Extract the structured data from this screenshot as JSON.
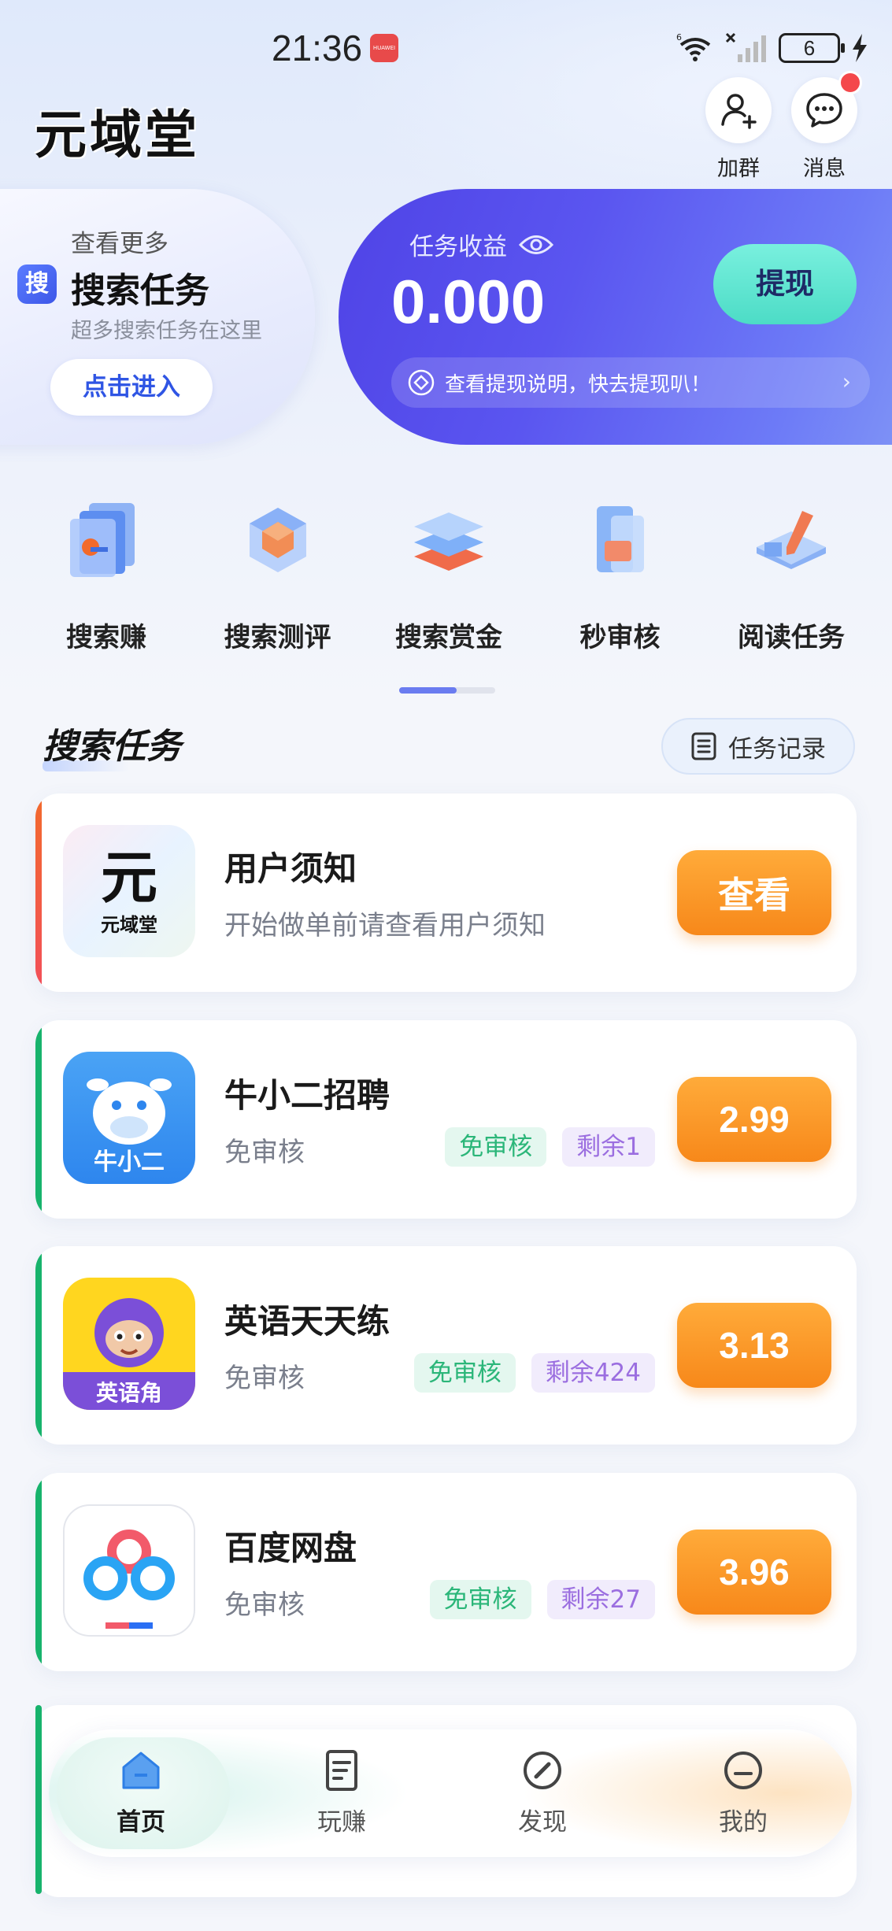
{
  "status_bar": {
    "time": "21:36",
    "carrier_badge": "HUAWEI",
    "battery": "6",
    "icons": [
      "wifi-6-icon",
      "no-sim-signal-icon",
      "battery-icon",
      "charging-icon"
    ]
  },
  "header": {
    "app_title": "元域堂",
    "join_group_label": "加群",
    "messages_label": "消息"
  },
  "promo": {
    "more": "查看更多",
    "badge": "搜",
    "title": "搜索任务",
    "subtitle": "超多搜索任务在这里",
    "enter_label": "点击进入"
  },
  "earnings": {
    "label": "任务收益",
    "value": "0.000",
    "withdraw_label": "提现",
    "note": "查看提现说明，快去提现叭！",
    "note_arrow": "›"
  },
  "categories": [
    {
      "label": "搜索赚",
      "icon": "search-earn-icon"
    },
    {
      "label": "搜索测评",
      "icon": "search-review-icon"
    },
    {
      "label": "搜索赏金",
      "icon": "search-bounty-icon"
    },
    {
      "label": "秒审核",
      "icon": "quick-review-icon"
    },
    {
      "label": "阅读任务",
      "icon": "reading-task-icon"
    }
  ],
  "category_scroll_progress": 0.6,
  "section": {
    "title": "搜索任务",
    "record_label": "任务记录"
  },
  "tasks": [
    {
      "name": "用户须知",
      "desc": "开始做单前请查看用户须知",
      "action": "查看",
      "icon_text_big": "元",
      "icon_text_small": "元域堂",
      "stripe": "#f26a2c"
    },
    {
      "name": "牛小二招聘",
      "desc": "免审核",
      "tag1": "免审核",
      "tag2": "剩余1",
      "action": "2.99",
      "icon_text": "牛小二",
      "stripe": "#17b36c"
    },
    {
      "name": "英语天天练",
      "desc": "免审核",
      "tag1": "免审核",
      "tag2": "剩余424",
      "action": "3.13",
      "icon_text": "英语角",
      "stripe": "#17b36c"
    },
    {
      "name": "百度网盘",
      "desc": "免审核",
      "tag1": "免审核",
      "tag2": "剩余27",
      "action": "3.96",
      "stripe": "#17b36c"
    }
  ],
  "nav": {
    "home": "首页",
    "play_earn": "玩赚",
    "discover": "发现",
    "mine": "我的"
  },
  "colors": {
    "accent_blue": "#4f43e6",
    "withdraw_teal": "#4cdcc6",
    "price_orange": "#f7881a",
    "tag_green": "#2bb679",
    "tag_purple": "#9b6ee0",
    "stripe_green": "#17b36c",
    "stripe_orange": "#f26a2c"
  }
}
